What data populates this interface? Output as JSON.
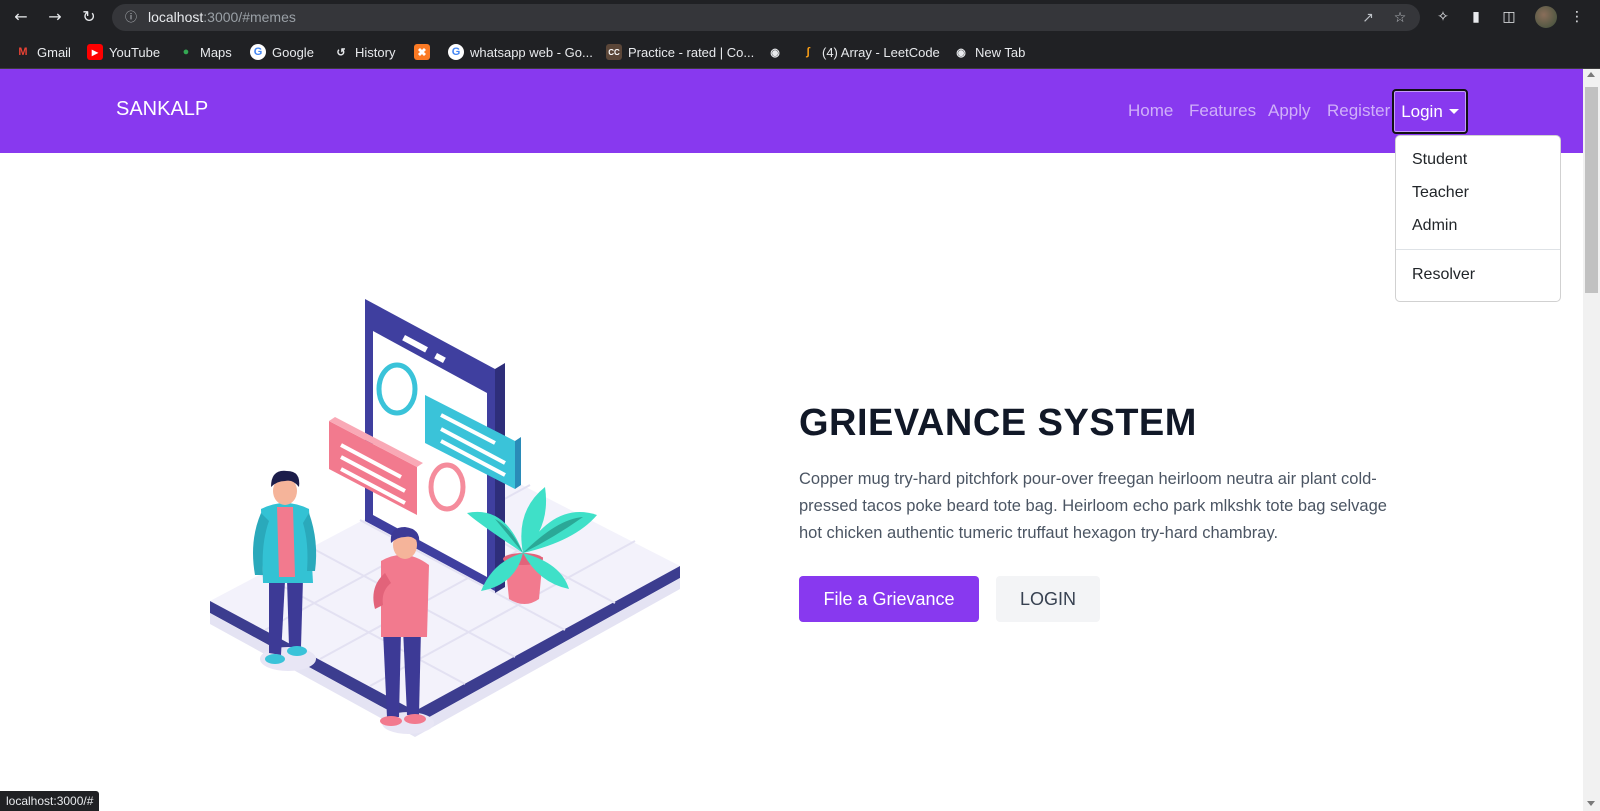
{
  "browser": {
    "url_host": "localhost",
    "url_rest": ":3000/#memes",
    "status_url": "localhost:3000/#",
    "bookmarks": [
      {
        "label": "Gmail",
        "icon": "gmail-icon"
      },
      {
        "label": "YouTube",
        "icon": "youtube-icon"
      },
      {
        "label": "Maps",
        "icon": "maps-icon"
      },
      {
        "label": "Google",
        "icon": "google-icon"
      },
      {
        "label": "History",
        "icon": "history-icon"
      },
      {
        "label": "",
        "icon": "xampp-icon"
      },
      {
        "label": "whatsapp web - Go...",
        "icon": "google-icon"
      },
      {
        "label": "Practice - rated | Co...",
        "icon": "codechef-icon"
      },
      {
        "label": "",
        "icon": "globe-icon"
      },
      {
        "label": "(4) Array - LeetCode",
        "icon": "leetcode-icon"
      },
      {
        "label": "New Tab",
        "icon": "globe-icon"
      }
    ]
  },
  "navbar": {
    "brand": "SANKALP",
    "links": [
      "Home",
      "Features",
      "Apply",
      "Register"
    ],
    "login": "Login"
  },
  "dropdown": {
    "items": [
      "Student",
      "Teacher",
      "Admin"
    ],
    "after_divider": "Resolver"
  },
  "hero": {
    "title": "GRIEVANCE SYSTEM",
    "description": "Copper mug try-hard pitchfork pour-over freegan heirloom neutra air plant cold-pressed tacos poke beard tote bag. Heirloom echo park mlkshk tote bag selvage hot chicken authentic tumeric truffaut hexagon try-hard chambray.",
    "primary_button": "File a Grievance",
    "secondary_button": "LOGIN"
  },
  "colors": {
    "brand_purple": "#8839ef",
    "chrome_dark": "#202124"
  }
}
